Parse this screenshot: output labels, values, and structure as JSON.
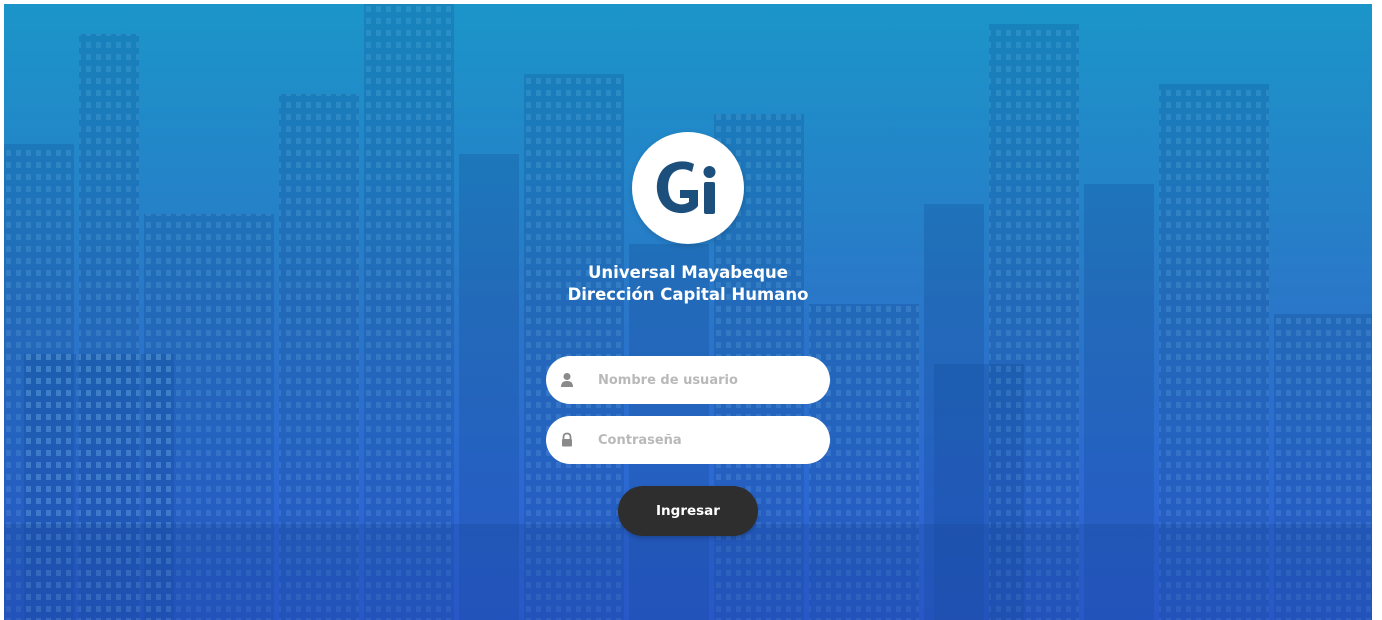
{
  "org": {
    "line1": "Universal Mayabeque",
    "line2": "Dirección Capital Humano",
    "logo_text": "Gi"
  },
  "form": {
    "username_placeholder": "Nombre de usuario",
    "password_placeholder": "Contraseña",
    "username_value": "",
    "password_value": "",
    "submit_label": "Ingresar"
  },
  "icons": {
    "username": "user-icon",
    "password": "lock-icon"
  },
  "colors": {
    "logo_blue": "#1d4f7d",
    "button_bg": "#2e2e2e",
    "background_top": "#1f8fc4",
    "background_bottom": "#2f5fd6"
  }
}
